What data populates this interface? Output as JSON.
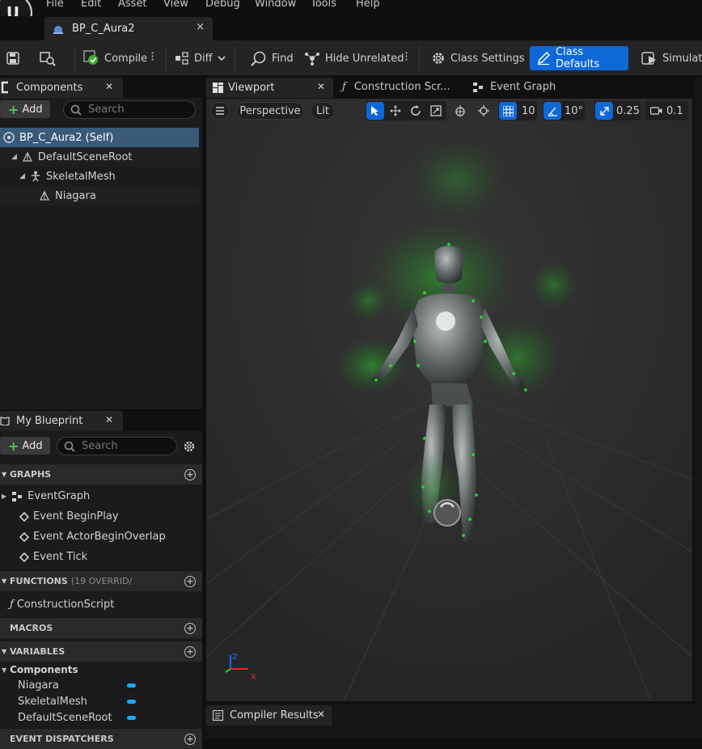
{
  "menu": [
    "File",
    "Edit",
    "Asset",
    "View",
    "Debug",
    "Window",
    "Tools",
    "Help"
  ],
  "asset_tab": {
    "title": "BP_C_Aura2",
    "close": "×"
  },
  "toolbar": {
    "compile": "Compile",
    "diff": "Diff",
    "find": "Find",
    "hide_unrelated": "Hide Unrelated",
    "class_settings": "Class Settings",
    "class_defaults": "Class Defaults",
    "simulation": "Simulation"
  },
  "components_panel": {
    "tab": "Components",
    "add": "Add",
    "search_placeholder": "Search",
    "tree": [
      "BP_C_Aura2 (Self)",
      "DefaultSceneRoot",
      "SkeletalMesh",
      "Niagara"
    ]
  },
  "my_blueprint": {
    "tab": "My Blueprint",
    "add": "Add",
    "search_placeholder": "Search",
    "graphs_header": "GRAPHS",
    "graphs": [
      "EventGraph",
      "Event BeginPlay",
      "Event ActorBeginOverlap",
      "Event Tick"
    ],
    "functions_header": "FUNCTIONS",
    "functions_note": "(19 OVERRID/",
    "functions": [
      "ConstructionScript"
    ],
    "macros_header": "MACROS",
    "variables_header": "VARIABLES",
    "variables_group": "Components",
    "variables": [
      "Niagara",
      "SkeletalMesh",
      "DefaultSceneRoot"
    ],
    "dispatchers_header": "EVENT DISPATCHERS"
  },
  "editor_tabs": {
    "viewport": "Viewport",
    "construction": "Construction Scr...",
    "event_graph": "Event Graph"
  },
  "viewport_toolbar": {
    "perspective": "Perspective",
    "lit": "Lit",
    "grid_snap": "10",
    "rotation_snap": "10°",
    "scale_snap": "0.25",
    "camera_speed": "0.1"
  },
  "gizmo": {
    "z": "Z",
    "x": "X"
  },
  "compiler_results": {
    "tab": "Compiler Results"
  },
  "colors": {
    "accent": "#0e68d8",
    "variable_pill": "#1aa8ff",
    "aura_green": "#22dd22"
  }
}
